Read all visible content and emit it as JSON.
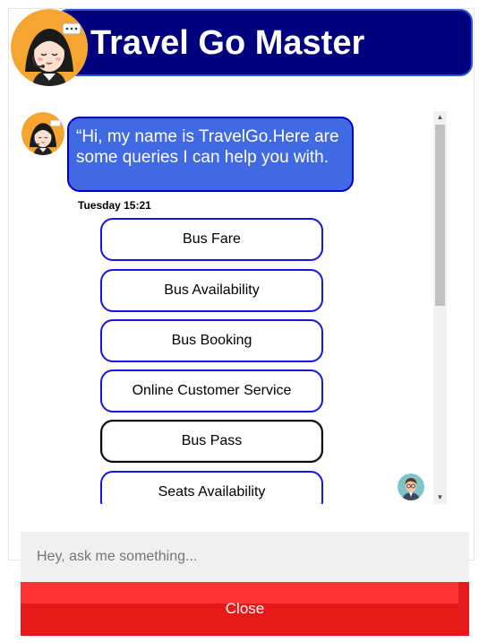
{
  "header": {
    "title": "Travel Go Master",
    "avatar_icon": "receptionist-avatar-icon"
  },
  "chat": {
    "bot_message": "“Hi, my name is TravelGo.Here are some queries I can help you with.",
    "timestamp": "Tuesday 15:21",
    "options": [
      "Bus Fare",
      "Bus Availability",
      "Bus Booking",
      "Online Customer Service",
      "Bus Pass",
      "Seats Availability"
    ],
    "focused_option": "Bus Pass"
  },
  "input": {
    "placeholder": "Hey, ask me something...",
    "value": ""
  },
  "close_label": "Close",
  "colors": {
    "header_bg": "#00007f",
    "bubble_bg": "#4169e1",
    "option_border": "#1515e0",
    "close_bg": "#e61919"
  }
}
